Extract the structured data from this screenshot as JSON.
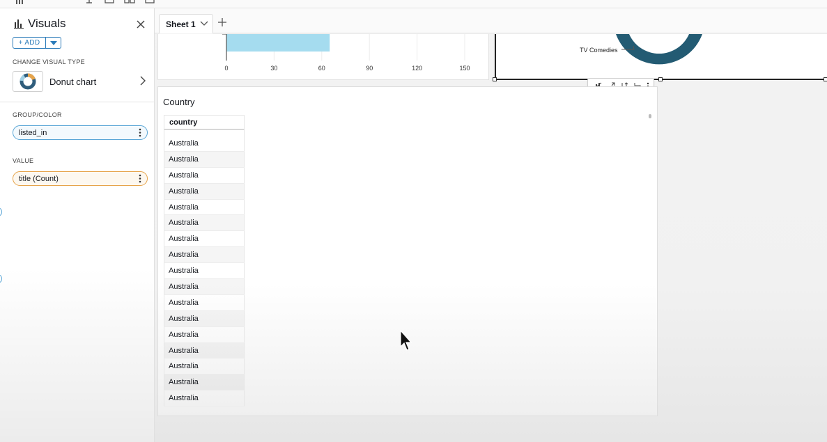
{
  "panel": {
    "title": "Visuals",
    "add_label": "+ ADD",
    "change_visual_type_label": "CHANGE VISUAL TYPE",
    "visual_type": "Donut chart",
    "group_color_label": "GROUP/COLOR",
    "group_color_field": "listed_in",
    "value_label": "VALUE",
    "value_field": "title (Count)"
  },
  "sheet": {
    "tab_label": "Sheet 1"
  },
  "bar_chart": {
    "x_ticks": [
      "0",
      "30",
      "60",
      "90",
      "120",
      "150"
    ],
    "visible_bar_value": 65,
    "x_max": 150
  },
  "donut_chart": {
    "label": "TV Comedies",
    "color": "#235b73"
  },
  "table_visual": {
    "title": "Country",
    "column_header": "country",
    "rows": [
      "Australia",
      "Australia",
      "Australia",
      "Australia",
      "Australia",
      "Australia",
      "Australia",
      "Australia",
      "Australia",
      "Australia",
      "Australia",
      "Australia",
      "Australia",
      "Australia",
      "Australia",
      "Australia",
      "Australia"
    ]
  },
  "colors": {
    "accent": "#2b7bb9",
    "bar": "#a5dcef",
    "value_pill": "#e6a44b",
    "group_pill": "#5aa6d6"
  }
}
